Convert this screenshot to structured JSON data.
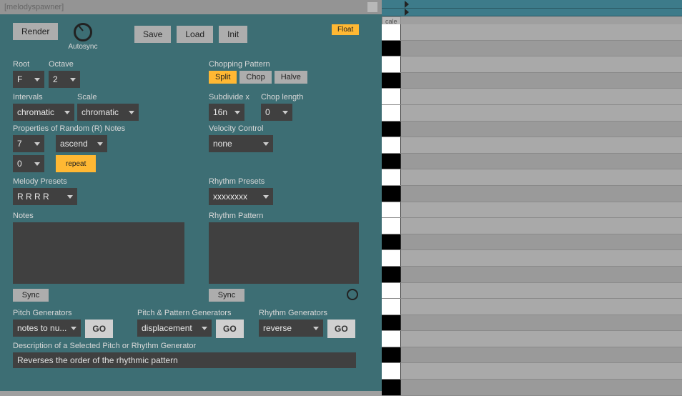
{
  "window": {
    "title": "[melodyspawner]"
  },
  "toolbar": {
    "render": "Render",
    "autosync": "Autosync",
    "save": "Save",
    "load": "Load",
    "init": "Init",
    "float": "Float"
  },
  "root": {
    "label": "Root",
    "value": "F"
  },
  "octave": {
    "label": "Octave",
    "value": "2"
  },
  "intervals": {
    "label": "Intervals",
    "value": "chromatic"
  },
  "scale": {
    "label": "Scale",
    "value": "chromatic"
  },
  "chopping": {
    "label": "Chopping Pattern",
    "split": "Split",
    "chop": "Chop",
    "halve": "Halve"
  },
  "subdivide": {
    "label": "Subdivide x",
    "value": "16n"
  },
  "choplen": {
    "label": "Chop length",
    "value": "0"
  },
  "randnotes": {
    "label": "Properties of Random (R) Notes",
    "count": "7",
    "direction": "ascend",
    "offset": "0",
    "repeat": "repeat"
  },
  "velocity": {
    "label": "Velocity Control",
    "value": "none"
  },
  "melody_presets": {
    "label": "Melody Presets",
    "value": "R R R R"
  },
  "rhythm_presets": {
    "label": "Rhythm Presets",
    "value": "xxxxxxxx"
  },
  "notes": {
    "label": "Notes",
    "value": ""
  },
  "rhythm_pattern": {
    "label": "Rhythm Pattern",
    "value": ""
  },
  "sync": "Sync",
  "pitch_gen": {
    "label": "Pitch Generators",
    "value": "notes to nu...",
    "go": "GO"
  },
  "pp_gen": {
    "label": "Pitch & Pattern Generators",
    "value": "displacement",
    "go": "GO"
  },
  "rhythm_gen": {
    "label": "Rhythm Generators",
    "value": "reverse",
    "go": "GO"
  },
  "description": {
    "label": "Description of a Selected Pitch or Rhythm Generator",
    "text": "Reverses the order of the rhythmic pattern"
  },
  "side": {
    "scale_label": "cale"
  }
}
